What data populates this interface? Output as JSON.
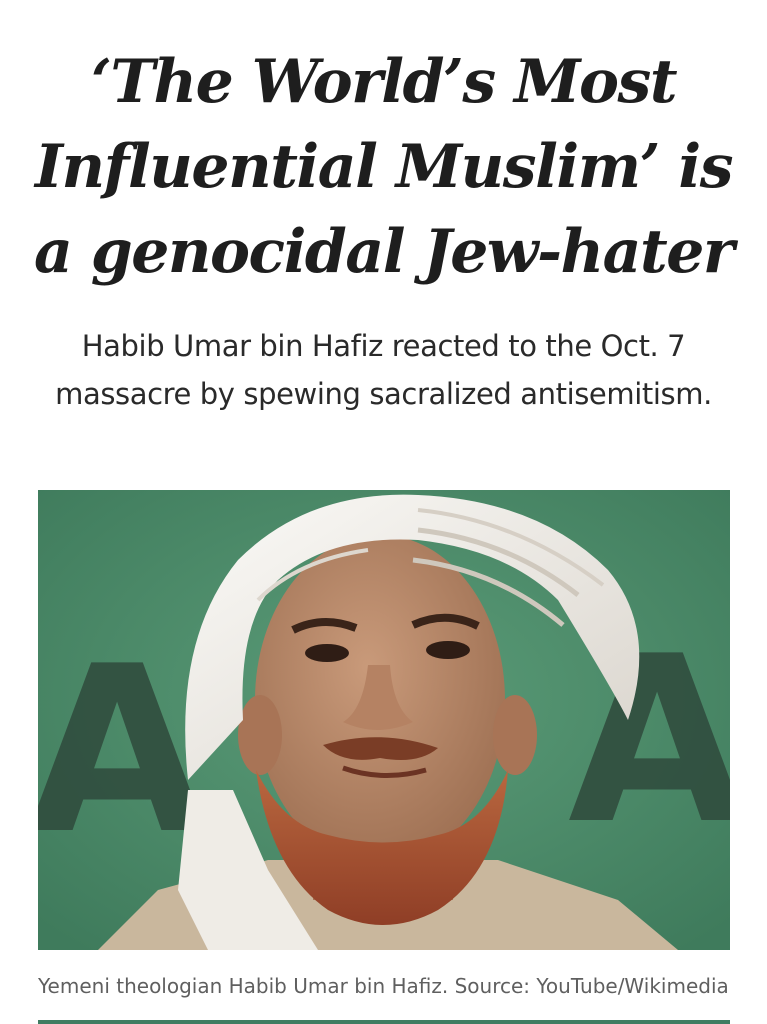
{
  "article": {
    "headline": "‘The World’s Most Influential Muslim’ is a genocidal Jew-hater",
    "subheadline": "Habib Umar bin Hafiz reacted to the Oct. 7 massacre by spewing sacralized antisemitism.",
    "image": {
      "background_letter": "A"
    },
    "caption": "Yemeni theologian Habib Umar bin Hafiz. Source: YouTube/Wikimedia"
  },
  "colors": {
    "photo_background": "#4e8f6c",
    "turban": "#f1eeea",
    "skin": "#bd8f70",
    "beard": "#b05a3a",
    "text_primary": "#1e1e1e",
    "caption_text": "#5f5f5f"
  }
}
